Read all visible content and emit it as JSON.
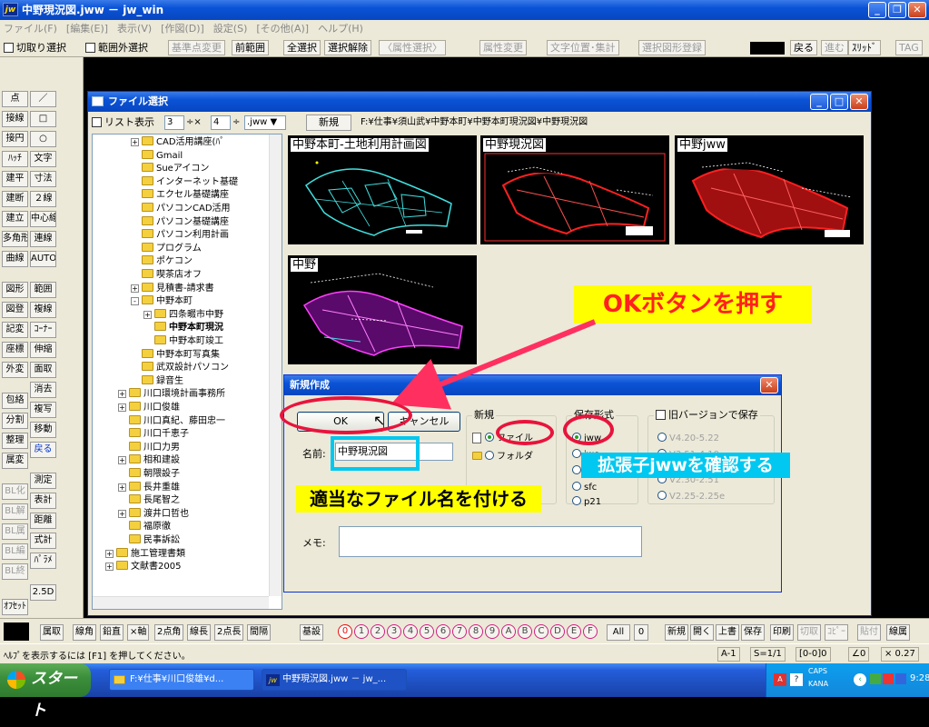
{
  "window": {
    "title": "中野現況図.jww － jw_win",
    "logo": "jw",
    "menu": [
      "ファイル(F)",
      "[編集(E)]",
      "表示(V)",
      "[作図(D)]",
      "設定(S)",
      "[その他(A)]",
      "ヘルプ(H)"
    ]
  },
  "toolbar": {
    "items": [
      "切取り選択",
      "範囲外選択",
      "基準点変更",
      "前範囲",
      "全選択",
      "選択解除",
      "〈属性選択〉",
      "属性変更",
      "文字位置･集計",
      "選択図形登録",
      "戻る",
      "進む",
      "ｽﾘｯﾄﾞ",
      "TAG"
    ]
  },
  "left_tools": {
    "col1": [
      "点",
      "接線",
      "接円",
      "ﾊｯﾁ",
      "建平",
      "建断",
      "建立",
      "多角形",
      "曲線",
      "図形",
      "図登",
      "記変",
      "座標",
      "外変",
      "包絡",
      "分割",
      "整理",
      "属変",
      "BL化",
      "BL解",
      "BL属",
      "BL編",
      "BL終",
      "ｵﾌｾｯﾄ"
    ],
    "col2": [
      "／",
      "□",
      "○",
      "文字",
      "寸法",
      "２線",
      "中心線",
      "連線",
      "AUTO",
      "範囲",
      "複線",
      "ｺｰﾅｰ",
      "伸縮",
      "面取",
      "消去",
      "複写",
      "移動",
      "戻る",
      "測定",
      "表計",
      "距離",
      "式計",
      "ﾊﾟﾗﾒ",
      "2.5D"
    ]
  },
  "file_dialog": {
    "title": "ファイル選択",
    "list_view_label": "リスト表示",
    "cols": "3",
    "rows": "4",
    "ext": ".jww",
    "new_button": "新規",
    "path": "F:¥仕事¥須山武¥中野本町¥中野本町現況図¥中野現況図",
    "tree": [
      {
        "label": "CAD活用講座(ﾊﾟ",
        "level": 2,
        "pm": "+"
      },
      {
        "label": "Gmail",
        "level": 2,
        "pm": ""
      },
      {
        "label": "Sueアイコン",
        "level": 2,
        "pm": ""
      },
      {
        "label": "インターネット基礎",
        "level": 2,
        "pm": ""
      },
      {
        "label": "エクセル基礎講座",
        "level": 2,
        "pm": ""
      },
      {
        "label": "パソコンCAD活用",
        "level": 2,
        "pm": ""
      },
      {
        "label": "パソコン基礎講座",
        "level": 2,
        "pm": ""
      },
      {
        "label": "パソコン利用計画",
        "level": 2,
        "pm": ""
      },
      {
        "label": "プログラム",
        "level": 2,
        "pm": ""
      },
      {
        "label": "ポケコン",
        "level": 2,
        "pm": ""
      },
      {
        "label": "喫茶店オフ",
        "level": 2,
        "pm": ""
      },
      {
        "label": "見積書-請求書",
        "level": 2,
        "pm": "+"
      },
      {
        "label": "中野本町",
        "level": 2,
        "pm": "-"
      },
      {
        "label": "四条畷市中野",
        "level": 3,
        "pm": "+"
      },
      {
        "label": "中野本町現況",
        "level": 3,
        "pm": "",
        "bold": true
      },
      {
        "label": "中野本町竣工",
        "level": 3,
        "pm": ""
      },
      {
        "label": "中野本町写真集",
        "level": 2,
        "pm": ""
      },
      {
        "label": "武双設計パソコン",
        "level": 2,
        "pm": ""
      },
      {
        "label": "録音生",
        "level": 2,
        "pm": ""
      },
      {
        "label": "川口環境計画事務所",
        "level": 1,
        "pm": "+"
      },
      {
        "label": "川口俊雄",
        "level": 1,
        "pm": "+"
      },
      {
        "label": "川口真紀、藤田忠一",
        "level": 1,
        "pm": ""
      },
      {
        "label": "川口千恵子",
        "level": 1,
        "pm": ""
      },
      {
        "label": "川口力男",
        "level": 1,
        "pm": ""
      },
      {
        "label": "相和建設",
        "level": 1,
        "pm": "+"
      },
      {
        "label": "朝隈設子",
        "level": 1,
        "pm": ""
      },
      {
        "label": "長井重雄",
        "level": 1,
        "pm": "+"
      },
      {
        "label": "長尾智之",
        "level": 1,
        "pm": ""
      },
      {
        "label": "渡井口哲也",
        "level": 1,
        "pm": "+"
      },
      {
        "label": "福原徹",
        "level": 1,
        "pm": ""
      },
      {
        "label": "民事訴訟",
        "level": 1,
        "pm": ""
      },
      {
        "label": "施工管理書類",
        "level": 0,
        "pm": "+"
      },
      {
        "label": "文献書2005",
        "level": 0,
        "pm": "+"
      }
    ],
    "thumbnails": [
      "中野本町-土地利用計画図",
      "中野現況図",
      "中野jww",
      "中野"
    ]
  },
  "new_dialog": {
    "title": "新規作成",
    "ok": "OK",
    "cancel": "キャンセル",
    "name_label": "名前:",
    "name_value": "中野現況図",
    "memo_label": "メモ:",
    "new_group": "新規",
    "new_file": "ファイル",
    "new_folder": "フォルダ",
    "format_group": "保存形式",
    "formats": [
      "jww",
      "jwc",
      "dxf",
      "sfc",
      "p21"
    ],
    "oldver_label": "旧バージョンで保存",
    "oldver_options": [
      "V4.20-5.22",
      "V3.51-4.10",
      "V2.30-2.51",
      "V2.25-2.25e"
    ]
  },
  "annotations": {
    "ok_hint": "OKボタンを押す",
    "ext_hint": "拡張子jwwを確認する",
    "name_hint": "適当なファイル名を付ける",
    "ok_color": "#ff2020",
    "note_bg": "#ffff00",
    "ext_color": "#00c8f0"
  },
  "layer_bar": {
    "items": [
      "属取",
      "線角",
      "鉛直",
      "×軸",
      "2点角",
      "線長",
      "2点長",
      "間隔",
      "基設"
    ],
    "layers": [
      "0",
      "1",
      "2",
      "3",
      "4",
      "5",
      "6",
      "7",
      "8",
      "9",
      "A",
      "B",
      "C",
      "D",
      "E",
      "F"
    ],
    "all": "All",
    "zero": "0",
    "actions": [
      "新規",
      "開く",
      "上書",
      "保存",
      "印刷",
      "切取",
      "ｺﾋﾟｰ",
      "貼付",
      "線属"
    ]
  },
  "status": {
    "help": "ﾍﾙﾌﾟを表示するには [F1] を押してください。",
    "paper": "A-1",
    "scale": "S=1/1",
    "layer": "[0-0]0",
    "angle": "∠0",
    "zoom": "× 0.27"
  },
  "taskbar": {
    "start": "スタート",
    "tasks": [
      "F:¥仕事¥川口俊雄¥d...",
      "中野現況図.jww － jw_..."
    ],
    "caps": "CAPS",
    "kana": "KANA",
    "time": "9:28"
  }
}
